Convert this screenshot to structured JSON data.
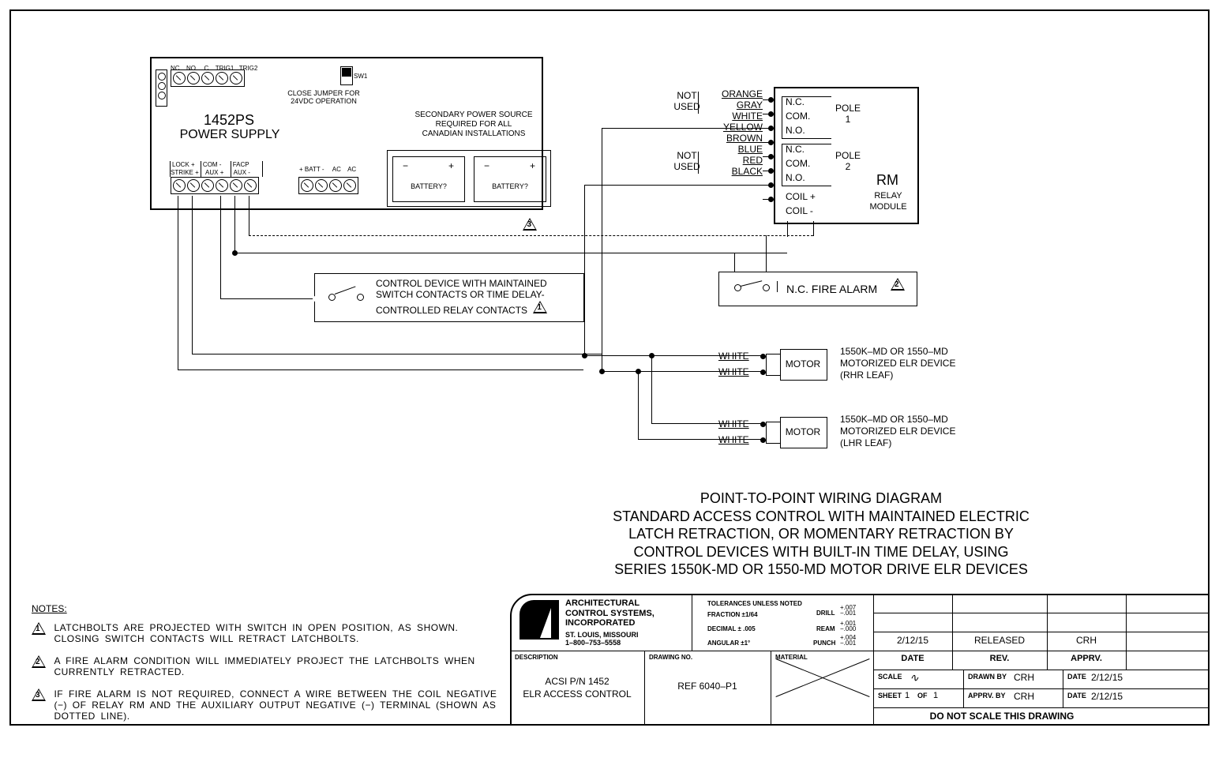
{
  "diagram": {
    "power_supply": {
      "model": "1452PS",
      "label": "POWER SUPPLY",
      "top_terminals": [
        "NC",
        "NO",
        "C",
        "TRIG1",
        "TRIG2"
      ],
      "sw1_label": "SW1",
      "jumper_note_l1": "CLOSE JUMPER FOR",
      "jumper_note_l2": "24VDC OPERATION",
      "secondary_l1": "SECONDARY POWER SOURCE",
      "secondary_l2": "REQUIRED FOR ALL",
      "secondary_l3": "CANADIAN INSTALLATIONS",
      "bottom_left_block_top": [
        "LOCK +",
        "COM -",
        "FACP"
      ],
      "bottom_left_block_sub": [
        "STRIKE +",
        "AUX +",
        "AUX -"
      ],
      "bottom_right_block": [
        "+ BATT -",
        "AC",
        "AC"
      ],
      "batt_label": "BATTERY?",
      "plus": "+",
      "minus": "−"
    },
    "relay": {
      "not_used": "NOT\nUSED",
      "wires": [
        "ORANGE",
        "GRAY",
        "WHITE",
        "YELLOW",
        "BROWN",
        "BLUE",
        "RED",
        "BLACK"
      ],
      "pole1": {
        "nc": "N.C.",
        "com": "COM.",
        "no": "N.O.",
        "label": "POLE\n1"
      },
      "pole2": {
        "nc": "N.C.",
        "com": "COM.",
        "no": "N.O.",
        "label": "POLE\n2"
      },
      "coilp": "COIL +",
      "coiln": "COIL -",
      "rm": "RM",
      "rm_l1": "RELAY",
      "rm_l2": "MODULE"
    },
    "control_device": {
      "l1": "CONTROL DEVICE WITH MAINTAINED",
      "l2": "SWITCH CONTACTS OR TIME DELAY-",
      "l3": "CONTROLLED RELAY CONTACTS"
    },
    "fire_alarm": "N.C. FIRE ALARM",
    "motor": {
      "white": "WHITE",
      "box": "MOTOR",
      "rhr_l1": "1550K–MD OR 1550–MD",
      "rhr_l2": "MOTORIZED ELR DEVICE",
      "rhr_l3": "(RHR LEAF)",
      "lhr_l3": "(LHR LEAF)"
    },
    "title": {
      "l1": "POINT-TO-POINT WIRING DIAGRAM",
      "l2": "STANDARD ACCESS CONTROL WITH MAINTAINED ELECTRIC",
      "l3": "LATCH RETRACTION, OR MOMENTARY RETRACTION BY",
      "l4": "CONTROL DEVICES WITH BUILT-IN TIME DELAY, USING",
      "l5": "SERIES 1550K-MD OR 1550-MD MOTOR DRIVE ELR DEVICES"
    },
    "notes_heading": "NOTES:",
    "notes": [
      "LATCHBOLTS ARE PROJECTED WITH SWITCH IN OPEN POSITION, AS SHOWN. CLOSING SWITCH CONTACTS WILL RETRACT LATCHBOLTS.",
      "A FIRE ALARM CONDITION WILL IMMEDIATELY PROJECT THE LATCHBOLTS WHEN CURRENTLY RETRACTED.",
      "IF FIRE ALARM IS NOT REQUIRED, CONNECT A WIRE BETWEEN THE COIL NEGATIVE (−) OF RELAY RM AND THE AUXILIARY OUTPUT NEGATIVE (−) TERMINAL (SHOWN AS DOTTED LINE)."
    ]
  },
  "titleblock": {
    "company_l1": "ARCHITECTURAL",
    "company_l2": "CONTROL SYSTEMS,",
    "company_l3": "INCORPORATED",
    "company_l4": "ST. LOUIS, MISSOURI",
    "company_l5": "1–800–753–5558",
    "tol_head": "TOLERANCES UNLESS NOTED",
    "tol_l1": "FRACTION ±1/64",
    "tol_l2": "DECIMAL ± .005",
    "tol_l3": "ANGULAR ±1°",
    "tol_r1l": "DRILL",
    "tol_r1v": "+.007\n−.001",
    "tol_r2l": "REAM",
    "tol_r2v": "+.001\n−.000",
    "tol_r3l": "PUNCH",
    "tol_r3v": "+.004\n−.001",
    "desc_head": "DESCRIPTION",
    "desc_l1": "ACSI P/N 1452",
    "desc_l2": "ELR ACCESS CONTROL",
    "dwg_head": "DRAWING NO.",
    "dwg_no": "REF 6040–P1",
    "mat_head": "MATERIAL",
    "rev_date": "2/12/15",
    "rev_text": "RELEASED",
    "rev_appr": "CRH",
    "h_date": "DATE",
    "h_rev": "REV.",
    "h_appr": "APPRV.",
    "scale_l": "SCALE",
    "scale_v": "∿",
    "drawn_by_l": "DRAWN BY",
    "drawn_by_v": "CRH",
    "drawn_date": "2/12/15",
    "sheet_l": "SHEET",
    "sheet_n": "1",
    "sheet_of": "OF",
    "sheet_t": "1",
    "appr_by_l": "APPRV. BY",
    "appr_by_v": "CRH",
    "appr_date": "2/12/15",
    "do_not_scale": "DO NOT SCALE THIS DRAWING",
    "date_small": "DATE"
  }
}
